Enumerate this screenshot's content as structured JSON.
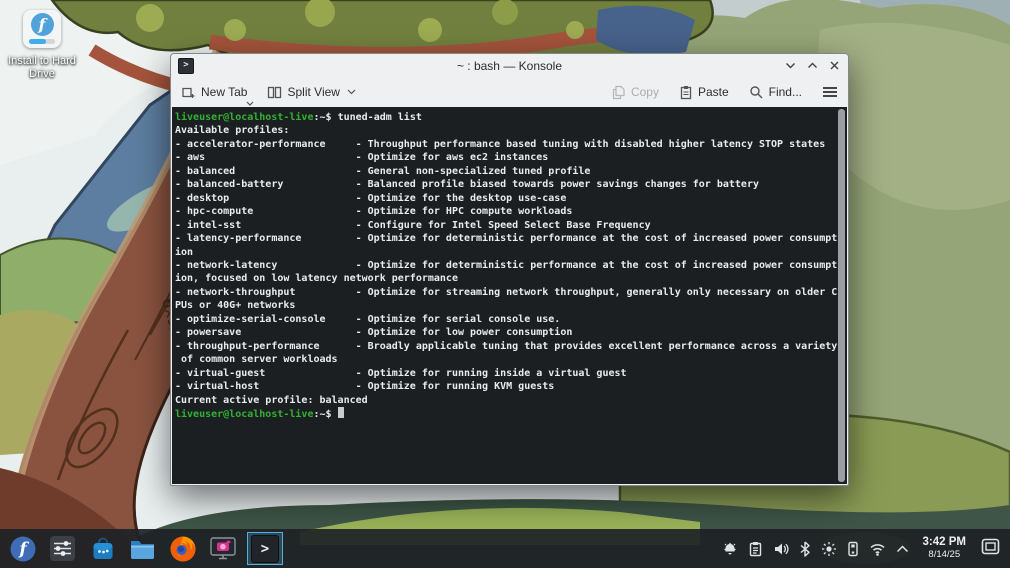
{
  "desktop_icon": {
    "label": "Install to Hard Drive",
    "icon": "fedora-installer-icon"
  },
  "window": {
    "title": "~ : bash — Konsole",
    "titlebar_controls": [
      "minimize",
      "maximize",
      "close"
    ],
    "toolbar": {
      "new_tab": "New Tab",
      "split_view": "Split View",
      "copy": "Copy",
      "paste": "Paste",
      "find": "Find...",
      "menu_icon": "hamburger-menu"
    },
    "terminal": {
      "lines": [
        {
          "s": [
            [
              "green",
              "liveuser@localhost-live"
            ],
            [
              "fg",
              ":~$ tuned-adm list"
            ]
          ]
        },
        {
          "s": [
            [
              "fg",
              "Available profiles:"
            ]
          ]
        },
        {
          "s": [
            [
              "fg",
              "- accelerator-performance     - Throughput performance based tuning with disabled higher latency STOP states"
            ]
          ]
        },
        {
          "s": [
            [
              "fg",
              "- aws                         - Optimize for aws ec2 instances"
            ]
          ]
        },
        {
          "s": [
            [
              "fg",
              "- balanced                    - General non-specialized tuned profile"
            ]
          ]
        },
        {
          "s": [
            [
              "fg",
              "- balanced-battery            - Balanced profile biased towards power savings changes for battery"
            ]
          ]
        },
        {
          "s": [
            [
              "fg",
              "- desktop                     - Optimize for the desktop use-case"
            ]
          ]
        },
        {
          "s": [
            [
              "fg",
              "- hpc-compute                 - Optimize for HPC compute workloads"
            ]
          ]
        },
        {
          "s": [
            [
              "fg",
              "- intel-sst                   - Configure for Intel Speed Select Base Frequency"
            ]
          ]
        },
        {
          "s": [
            [
              "fg",
              "- latency-performance         - Optimize for deterministic performance at the cost of increased power consumpt"
            ]
          ]
        },
        {
          "s": [
            [
              "fg",
              "ion"
            ]
          ]
        },
        {
          "s": [
            [
              "fg",
              "- network-latency             - Optimize for deterministic performance at the cost of increased power consumpt"
            ]
          ]
        },
        {
          "s": [
            [
              "fg",
              "ion, focused on low latency network performance"
            ]
          ]
        },
        {
          "s": [
            [
              "fg",
              "- network-throughput          - Optimize for streaming network throughput, generally only necessary on older C"
            ]
          ]
        },
        {
          "s": [
            [
              "fg",
              "PUs or 40G+ networks"
            ]
          ]
        },
        {
          "s": [
            [
              "fg",
              "- optimize-serial-console     - Optimize for serial console use."
            ]
          ]
        },
        {
          "s": [
            [
              "fg",
              "- powersave                   - Optimize for low power consumption"
            ]
          ]
        },
        {
          "s": [
            [
              "fg",
              "- throughput-performance      - Broadly applicable tuning that provides excellent performance across a variety"
            ]
          ]
        },
        {
          "s": [
            [
              "fg",
              " of common server workloads"
            ]
          ]
        },
        {
          "s": [
            [
              "fg",
              "- virtual-guest               - Optimize for running inside a virtual guest"
            ]
          ]
        },
        {
          "s": [
            [
              "fg",
              "- virtual-host                - Optimize for running KVM guests"
            ]
          ]
        },
        {
          "s": [
            [
              "fg",
              "Current active profile: balanced"
            ]
          ]
        },
        {
          "s": [
            [
              "green",
              "liveuser@localhost-live"
            ],
            [
              "fg",
              ":~$ "
            ]
          ],
          "cursor": true
        }
      ]
    }
  },
  "taskbar": {
    "launchers": [
      "app-launcher-fedora",
      "system-settings",
      "discover-software",
      "dolphin-file-manager",
      "firefox",
      "spectacle-screenshot"
    ],
    "active_task": "konsole",
    "tray_icons": [
      "software-updates",
      "clipboard",
      "volume",
      "bluetooth",
      "brightness",
      "device-notifier",
      "wifi",
      "expand-tray"
    ],
    "clock": {
      "time": "3:42 PM",
      "date": "8/14/25"
    },
    "show_desktop": "show-desktop"
  },
  "colors": {
    "accent": "#3daee9",
    "terminal_bg": "#1c1f22",
    "terminal_green": "#32b232",
    "fedora_blue": "#51a2da",
    "titlebar_bg": "#eff0f1",
    "taskbar_bg": "#1e2226"
  }
}
